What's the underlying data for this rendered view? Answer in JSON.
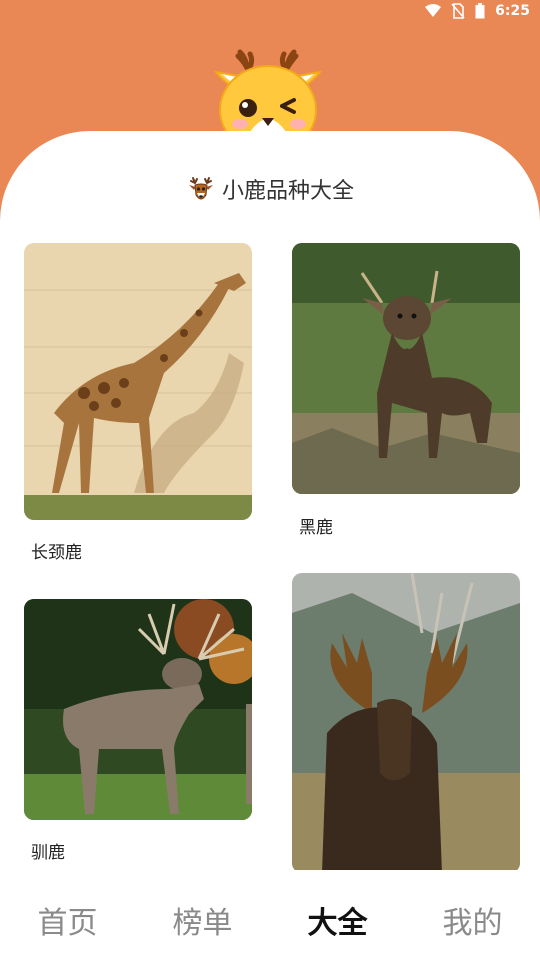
{
  "status": {
    "time": "6:25"
  },
  "header": {
    "title": "小鹿品种大全"
  },
  "cards": [
    {
      "name": "长颈鹿"
    },
    {
      "name": "黑鹿"
    },
    {
      "name": "驯鹿"
    },
    {
      "name": ""
    }
  ],
  "nav": {
    "items": [
      "首页",
      "榜单",
      "大全",
      "我的"
    ],
    "active_index": 2
  },
  "colors": {
    "brand": "#E98755",
    "text_primary": "#333333",
    "nav_inactive": "#8a8a8a",
    "nav_active": "#111111"
  }
}
